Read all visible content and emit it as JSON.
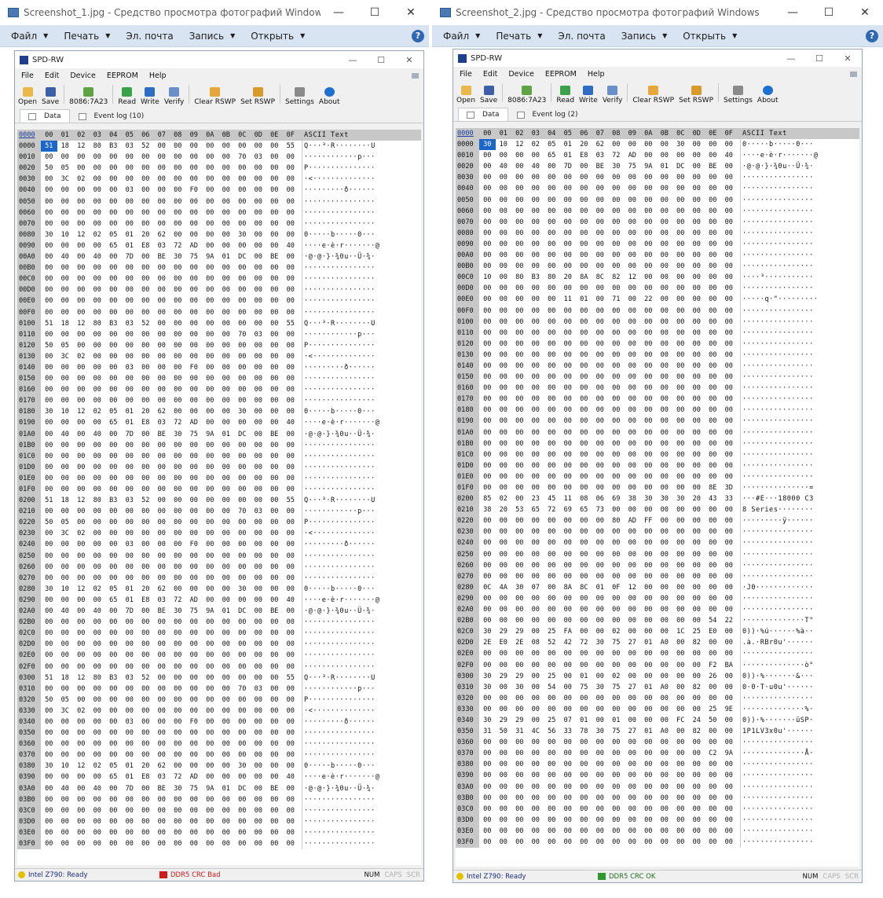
{
  "left": {
    "viewer_title": "Screenshot_1.jpg - Средство просмотра фотографий Windows",
    "viewer_menu": [
      "Файл",
      "Печать",
      "Эл. почта",
      "Запись",
      "Открыть"
    ],
    "spd_title": "SPD-RW",
    "spd_menu": [
      "File",
      "Edit",
      "Device",
      "EEPROM",
      "Help"
    ],
    "toolbar": {
      "open": "Open",
      "save": "Save",
      "device": "8086:7A23",
      "read": "Read",
      "write": "Write",
      "verify": "Verify",
      "clear": "Clear RSWP",
      "set": "Set RSWP",
      "settings": "Settings",
      "about": "About"
    },
    "tabs": {
      "data": "Data",
      "log": "Event log (10)"
    },
    "header_addr": "0000",
    "columns": [
      "00",
      "01",
      "02",
      "03",
      "04",
      "05",
      "06",
      "07",
      "08",
      "09",
      "0A",
      "0B",
      "0C",
      "0D",
      "0E",
      "0F"
    ],
    "ascii_header": "ASCII Text",
    "hex": {
      "0000": [
        "51",
        "18",
        "12",
        "80",
        "B3",
        "03",
        "52",
        "00",
        "00",
        "00",
        "00",
        "00",
        "00",
        "00",
        "00",
        "55"
      ],
      "0010": [
        "00",
        "00",
        "00",
        "00",
        "00",
        "00",
        "00",
        "00",
        "00",
        "00",
        "00",
        "00",
        "70",
        "03",
        "00",
        "00"
      ],
      "0020": [
        "50",
        "05",
        "00",
        "00",
        "00",
        "00",
        "00",
        "00",
        "00",
        "00",
        "00",
        "00",
        "00",
        "00",
        "00",
        "00"
      ],
      "0030": [
        "00",
        "3C",
        "02",
        "00",
        "00",
        "00",
        "00",
        "00",
        "00",
        "00",
        "00",
        "00",
        "00",
        "00",
        "00",
        "00"
      ],
      "0040": [
        "00",
        "00",
        "00",
        "00",
        "00",
        "03",
        "00",
        "00",
        "00",
        "F0",
        "00",
        "00",
        "00",
        "00",
        "00",
        "00"
      ],
      "0080": [
        "30",
        "10",
        "12",
        "02",
        "05",
        "01",
        "20",
        "62",
        "00",
        "00",
        "00",
        "00",
        "30",
        "00",
        "00",
        "00"
      ],
      "0090": [
        "00",
        "00",
        "00",
        "00",
        "65",
        "01",
        "E8",
        "03",
        "72",
        "AD",
        "00",
        "00",
        "00",
        "00",
        "00",
        "40"
      ],
      "00A0": [
        "00",
        "40",
        "00",
        "40",
        "00",
        "7D",
        "00",
        "BE",
        "30",
        "75",
        "9A",
        "01",
        "DC",
        "00",
        "BE",
        "00"
      ]
    },
    "ascii": {
      "0000": "Q···³·R········U",
      "0010": "············p···",
      "0020": "P···············",
      "0030": "·<··············",
      "0040": "·········ð······",
      "0080": "0·····b·····0···",
      "0090": "····e·è·r·······@",
      "00A0": "·@·@·}·¾0u··Ü·¾·"
    },
    "status": {
      "left": "Intel Z790: Ready",
      "mid": "DDR5 CRC Bad",
      "num": "NUM",
      "caps": "CAPS",
      "scr": "SCR"
    },
    "colors": {
      "crc": "#d11a1a"
    }
  },
  "right": {
    "viewer_title": "Screenshot_2.jpg - Средство просмотра фотографий Windows",
    "viewer_menu": [
      "Файл",
      "Печать",
      "Эл. почта",
      "Запись",
      "Открыть"
    ],
    "spd_title": "SPD-RW",
    "spd_menu": [
      "File",
      "Edit",
      "Device",
      "EEPROM",
      "Help"
    ],
    "toolbar": {
      "open": "Open",
      "save": "Save",
      "device": "8086:7A23",
      "read": "Read",
      "write": "Write",
      "verify": "Verify",
      "clear": "Clear RSWP",
      "set": "Set RSWP",
      "settings": "Settings",
      "about": "About"
    },
    "tabs": {
      "data": "Data",
      "log": "Event log (2)"
    },
    "header_addr": "0000",
    "columns": [
      "00",
      "01",
      "02",
      "03",
      "04",
      "05",
      "06",
      "07",
      "08",
      "09",
      "0A",
      "0B",
      "0C",
      "0D",
      "0E",
      "0F"
    ],
    "ascii_header": "ASCII Text",
    "hex": {
      "0000": [
        "30",
        "10",
        "12",
        "02",
        "05",
        "01",
        "20",
        "62",
        "00",
        "00",
        "00",
        "00",
        "30",
        "00",
        "00",
        "00"
      ],
      "0010": [
        "00",
        "00",
        "00",
        "00",
        "65",
        "01",
        "E8",
        "03",
        "72",
        "AD",
        "00",
        "00",
        "00",
        "00",
        "00",
        "40"
      ],
      "0020": [
        "00",
        "40",
        "00",
        "40",
        "00",
        "7D",
        "00",
        "BE",
        "30",
        "75",
        "9A",
        "01",
        "DC",
        "00",
        "BE",
        "00"
      ],
      "00C0": [
        "10",
        "00",
        "80",
        "B3",
        "80",
        "20",
        "8A",
        "8C",
        "82",
        "12",
        "00",
        "00",
        "00",
        "00",
        "00",
        "00"
      ],
      "00E0": [
        "00",
        "00",
        "00",
        "00",
        "00",
        "11",
        "01",
        "00",
        "71",
        "00",
        "22",
        "00",
        "00",
        "00",
        "00",
        "00"
      ],
      "01F0": [
        "00",
        "00",
        "00",
        "00",
        "00",
        "00",
        "00",
        "00",
        "00",
        "00",
        "00",
        "00",
        "00",
        "00",
        "8E",
        "3D"
      ],
      "0200": [
        "85",
        "02",
        "00",
        "23",
        "45",
        "11",
        "08",
        "06",
        "69",
        "38",
        "30",
        "30",
        "30",
        "20",
        "43",
        "33"
      ],
      "0210": [
        "38",
        "20",
        "53",
        "65",
        "72",
        "69",
        "65",
        "73",
        "00",
        "00",
        "00",
        "00",
        "00",
        "00",
        "00",
        "00"
      ],
      "0220": [
        "00",
        "00",
        "00",
        "00",
        "00",
        "00",
        "00",
        "00",
        "80",
        "AD",
        "FF",
        "00",
        "00",
        "00",
        "00",
        "00"
      ],
      "0280": [
        "0C",
        "4A",
        "30",
        "07",
        "00",
        "8A",
        "8C",
        "01",
        "0F",
        "12",
        "00",
        "00",
        "00",
        "00",
        "00",
        "00"
      ],
      "02B0": [
        "00",
        "00",
        "00",
        "00",
        "00",
        "00",
        "00",
        "00",
        "00",
        "00",
        "00",
        "00",
        "00",
        "00",
        "54",
        "22"
      ],
      "02C0": [
        "30",
        "29",
        "29",
        "00",
        "25",
        "FA",
        "00",
        "00",
        "02",
        "00",
        "00",
        "00",
        "1C",
        "25",
        "E0",
        "00"
      ],
      "02D0": [
        "2E",
        "E0",
        "2E",
        "08",
        "52",
        "42",
        "72",
        "30",
        "75",
        "27",
        "01",
        "A0",
        "00",
        "82",
        "00",
        "00"
      ],
      "02F0": [
        "00",
        "00",
        "00",
        "00",
        "00",
        "00",
        "00",
        "00",
        "00",
        "00",
        "00",
        "00",
        "00",
        "00",
        "F2",
        "BA"
      ],
      "0300": [
        "30",
        "29",
        "29",
        "00",
        "25",
        "00",
        "01",
        "00",
        "02",
        "00",
        "00",
        "00",
        "00",
        "00",
        "26",
        "00"
      ],
      "0310": [
        "30",
        "00",
        "30",
        "00",
        "54",
        "00",
        "75",
        "30",
        "75",
        "27",
        "01",
        "A0",
        "00",
        "82",
        "00",
        "00"
      ],
      "0330": [
        "00",
        "00",
        "00",
        "00",
        "00",
        "00",
        "00",
        "00",
        "00",
        "00",
        "00",
        "00",
        "00",
        "00",
        "25",
        "9E"
      ],
      "0340": [
        "30",
        "29",
        "29",
        "00",
        "25",
        "07",
        "01",
        "00",
        "01",
        "00",
        "00",
        "00",
        "FC",
        "24",
        "50",
        "00"
      ],
      "0350": [
        "31",
        "50",
        "31",
        "4C",
        "56",
        "33",
        "78",
        "30",
        "75",
        "27",
        "01",
        "A0",
        "00",
        "82",
        "00",
        "00"
      ],
      "0370": [
        "00",
        "00",
        "00",
        "00",
        "00",
        "00",
        "00",
        "00",
        "00",
        "00",
        "00",
        "00",
        "00",
        "00",
        "C2",
        "9A"
      ]
    },
    "ascii": {
      "0000": "0·····b·····0···",
      "0010": "····e·è·r·······@",
      "0020": "·@·@·}·¾0u··Ü·¾·",
      "00C0": "····³···········",
      "00E0": "·····q·\"·········",
      "01F0": "···············=",
      "0200": "···#E···18000 C3",
      "0210": "8 Series········",
      "0220": "·········ÿ······",
      "0280": "·J0·············",
      "02B0": "··············T\"",
      "02C0": "0))·%ú······%à··",
      "02D0": ".à.·RBr0u'······",
      "02F0": "··············ò°",
      "0300": "0))·%·······&···",
      "0310": "0·0·T·u0u'······",
      "0330": "··············%·",
      "0340": "0))·%·······üSP·",
      "0350": "1P1LV3x0u'······",
      "0370": "··············Å·"
    },
    "status": {
      "left": "Intel Z790: Ready",
      "mid": "DDR5 CRC OK",
      "num": "NUM",
      "caps": "CAPS",
      "scr": "SCR"
    },
    "colors": {
      "crc": "#2e9a2e"
    }
  }
}
